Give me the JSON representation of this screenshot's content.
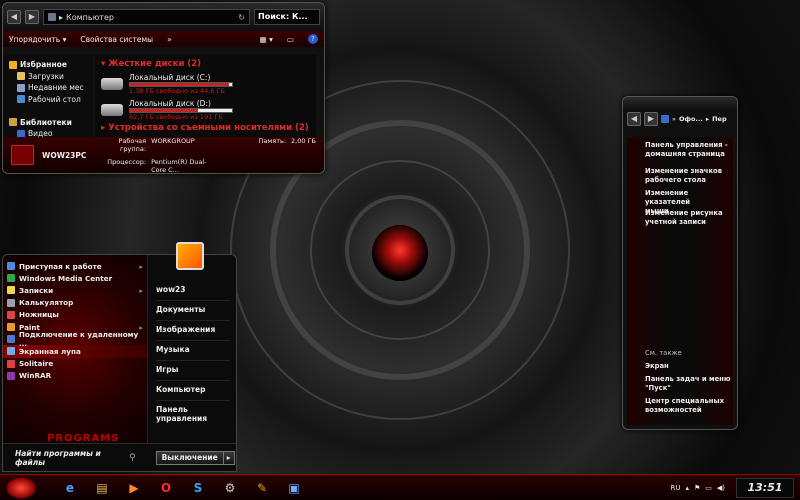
{
  "colors": {
    "accent": "#c41a1a",
    "dark_red": "#3a0000",
    "window_bg": "#101010",
    "highlight": "#8a0000"
  },
  "explorer": {
    "breadcrumb_sep": "▸",
    "location": "Компьютер",
    "search": "Поиск: К...",
    "toolbar": {
      "organize": "Упорядочить",
      "system_props": "Свойства системы",
      "more": "»"
    },
    "nav": [
      {
        "label": "Избранное",
        "icon": "star-icon",
        "group": true
      },
      {
        "label": "Загрузки",
        "icon": "downloads-folder-icon",
        "group": false
      },
      {
        "label": "Недавние мес",
        "icon": "recent-places-icon",
        "group": false
      },
      {
        "label": "Рабочий стол",
        "icon": "desktop-icon",
        "group": false
      },
      {
        "label": "",
        "icon": "",
        "group": false
      },
      {
        "label": "Библиотеки",
        "icon": "libraries-icon",
        "group": true
      },
      {
        "label": "Видео",
        "icon": "video-icon",
        "group": false
      }
    ],
    "section_hdd": "Жесткие диски (2)",
    "drives": [
      {
        "name": "Локальный диск (C:)",
        "free": "1,38 ГБ свободно из 44,6 ГБ",
        "used_fraction": 0.97
      },
      {
        "name": "Локальный диск (D:)",
        "free": "62,7 ГБ свободно из 191 ГБ",
        "used_fraction": 0.67
      }
    ],
    "section_removable": "Устройства со съемными носителями (2)",
    "details": {
      "pc_name": "WOW23PC",
      "workgroup_label": "Рабочая группа:",
      "workgroup": "WORKGROUP",
      "memory_label": "Память:",
      "memory": "2,00 ГБ",
      "cpu_label": "Процессор:",
      "cpu": "Pentium(R) Dual-Core  C..."
    }
  },
  "start_menu": {
    "programs": [
      {
        "label": "Приступая к работе",
        "icon": "getting-started-icon",
        "color": "#4a8be0",
        "submenu": true,
        "selected": false
      },
      {
        "label": "Windows Media Center",
        "icon": "media-center-icon",
        "color": "#2aa84a",
        "submenu": false,
        "selected": false
      },
      {
        "label": "Записки",
        "icon": "sticky-notes-icon",
        "color": "#e8d84a",
        "submenu": true,
        "selected": false
      },
      {
        "label": "Калькулятор",
        "icon": "calculator-icon",
        "color": "#9aa0a8",
        "submenu": false,
        "selected": false
      },
      {
        "label": "Ножницы",
        "icon": "scissors-icon",
        "color": "#d44",
        "submenu": false,
        "selected": false
      },
      {
        "label": "Paint",
        "icon": "paint-icon",
        "color": "#e89a2a",
        "submenu": true,
        "selected": false
      },
      {
        "label": "Подключение к удаленному ...",
        "icon": "remote-desktop-icon",
        "color": "#4a7ad0",
        "submenu": false,
        "selected": false
      },
      {
        "label": "Экранная лупа",
        "icon": "magnifier-icon",
        "color": "#6ab0e8",
        "submenu": false,
        "selected": true
      },
      {
        "label": "Solitaire",
        "icon": "solitaire-icon",
        "color": "#e04040",
        "submenu": false,
        "selected": false
      },
      {
        "label": "WinRAR",
        "icon": "winrar-icon",
        "color": "#8a3ab0",
        "submenu": false,
        "selected": false
      }
    ],
    "programs_label": "PROGRAMS",
    "right": [
      "wow23",
      "Документы",
      "Изображения",
      "Музыка",
      "Игры",
      "Компьютер",
      "Панель управления"
    ],
    "search_placeholder": "Найти программы и файлы",
    "shutdown": "Выключение",
    "shutdown_arrow": "▸"
  },
  "control_panel": {
    "crumbs": [
      "Офо...",
      "Пер"
    ],
    "links": [
      "Панель управления -\nдомашняя страница",
      "Изменение значков\nрабочего стола",
      "Изменение указателей\nмыши",
      "Изменение рисунка\nучетной записи"
    ],
    "see_also_label": "См. также",
    "see_also": [
      "Экран",
      "Панель задач и меню\n\"Пуск\"",
      "Центр специальных\nвозможностей"
    ]
  },
  "taskbar": {
    "apps": [
      {
        "name": "internet-explorer-icon",
        "glyph": "e",
        "color": "#4aa0ff"
      },
      {
        "name": "explorer-folder-icon",
        "glyph": "▤",
        "color": "#e8c060"
      },
      {
        "name": "media-player-icon",
        "glyph": "▶",
        "color": "#ff8a2a"
      },
      {
        "name": "opera-icon",
        "glyph": "O",
        "color": "#ff2a2a"
      },
      {
        "name": "skype-icon",
        "glyph": "S",
        "color": "#2aa8f0"
      },
      {
        "name": "steam-icon",
        "glyph": "⚙",
        "color": "#cccccc"
      },
      {
        "name": "paint-icon",
        "glyph": "✎",
        "color": "#e8a020"
      },
      {
        "name": "remote-desktop-icon",
        "glyph": "▣",
        "color": "#6ab0ff"
      }
    ],
    "lang": "RU",
    "clock": "13:51"
  }
}
